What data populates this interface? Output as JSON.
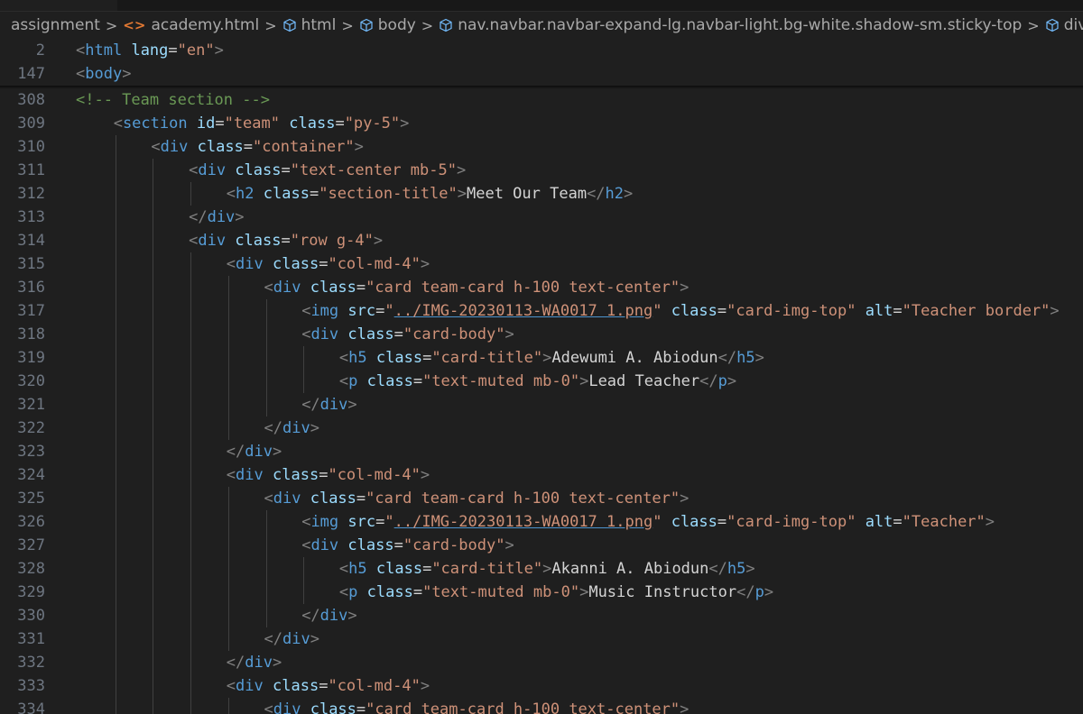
{
  "breadcrumb": {
    "folder": "assignment",
    "file": "academy.html",
    "nodes": [
      "html",
      "body",
      "nav.navbar.navbar-expand-lg.navbar-light.bg-white.shadow-sm.sticky-top",
      "div.container"
    ],
    "icons": {
      "file": "html-file-icon",
      "node": "symbol-element-icon"
    }
  },
  "sticky_lines": [
    {
      "number": "2",
      "tokens": [
        [
          "tg",
          "<"
        ],
        [
          "tn",
          "html"
        ],
        [
          "tx",
          " "
        ],
        [
          "at",
          "lang"
        ],
        [
          "tx",
          "="
        ],
        [
          "st",
          "\"en\""
        ],
        [
          "tg",
          ">"
        ]
      ]
    },
    {
      "number": "147",
      "tokens": [
        [
          "tg",
          "<"
        ],
        [
          "tn",
          "body"
        ],
        [
          "tg",
          ">"
        ]
      ]
    }
  ],
  "lines": [
    {
      "number": "308",
      "indent": 0,
      "tokens": [
        [
          "cm",
          "<!-- Team section -->"
        ]
      ]
    },
    {
      "number": "309",
      "indent": 1,
      "tokens": [
        [
          "tg",
          "<"
        ],
        [
          "tn",
          "section"
        ],
        [
          "tx",
          " "
        ],
        [
          "at",
          "id"
        ],
        [
          "tx",
          "="
        ],
        [
          "st",
          "\"team\""
        ],
        [
          "tx",
          " "
        ],
        [
          "at",
          "class"
        ],
        [
          "tx",
          "="
        ],
        [
          "st",
          "\"py-5\""
        ],
        [
          "tg",
          ">"
        ]
      ]
    },
    {
      "number": "310",
      "indent": 2,
      "tokens": [
        [
          "tg",
          "<"
        ],
        [
          "tn",
          "div"
        ],
        [
          "tx",
          " "
        ],
        [
          "at",
          "class"
        ],
        [
          "tx",
          "="
        ],
        [
          "st",
          "\"container\""
        ],
        [
          "tg",
          ">"
        ]
      ]
    },
    {
      "number": "311",
      "indent": 3,
      "tokens": [
        [
          "tg",
          "<"
        ],
        [
          "tn",
          "div"
        ],
        [
          "tx",
          " "
        ],
        [
          "at",
          "class"
        ],
        [
          "tx",
          "="
        ],
        [
          "st",
          "\"text-center mb-5\""
        ],
        [
          "tg",
          ">"
        ]
      ]
    },
    {
      "number": "312",
      "indent": 4,
      "tokens": [
        [
          "tg",
          "<"
        ],
        [
          "tn",
          "h2"
        ],
        [
          "tx",
          " "
        ],
        [
          "at",
          "class"
        ],
        [
          "tx",
          "="
        ],
        [
          "st",
          "\"section-title\""
        ],
        [
          "tg",
          ">"
        ],
        [
          "tx",
          "Meet Our Team"
        ],
        [
          "tg",
          "</"
        ],
        [
          "tn",
          "h2"
        ],
        [
          "tg",
          ">"
        ]
      ]
    },
    {
      "number": "313",
      "indent": 3,
      "tokens": [
        [
          "tg",
          "</"
        ],
        [
          "tn",
          "div"
        ],
        [
          "tg",
          ">"
        ]
      ]
    },
    {
      "number": "314",
      "indent": 3,
      "tokens": [
        [
          "tg",
          "<"
        ],
        [
          "tn",
          "div"
        ],
        [
          "tx",
          " "
        ],
        [
          "at",
          "class"
        ],
        [
          "tx",
          "="
        ],
        [
          "st",
          "\"row g-4\""
        ],
        [
          "tg",
          ">"
        ]
      ]
    },
    {
      "number": "315",
      "indent": 4,
      "tokens": [
        [
          "tg",
          "<"
        ],
        [
          "tn",
          "div"
        ],
        [
          "tx",
          " "
        ],
        [
          "at",
          "class"
        ],
        [
          "tx",
          "="
        ],
        [
          "st",
          "\"col-md-4\""
        ],
        [
          "tg",
          ">"
        ]
      ]
    },
    {
      "number": "316",
      "indent": 5,
      "tokens": [
        [
          "tg",
          "<"
        ],
        [
          "tn",
          "div"
        ],
        [
          "tx",
          " "
        ],
        [
          "at",
          "class"
        ],
        [
          "tx",
          "="
        ],
        [
          "st",
          "\"card team-card h-100 text-center\""
        ],
        [
          "tg",
          ">"
        ]
      ]
    },
    {
      "number": "317",
      "indent": 6,
      "tokens": [
        [
          "tg",
          "<"
        ],
        [
          "tn",
          "img"
        ],
        [
          "tx",
          " "
        ],
        [
          "at",
          "src"
        ],
        [
          "tx",
          "="
        ],
        [
          "st",
          "\""
        ],
        [
          "stu",
          "../IMG-20230113-WA0017 1.png"
        ],
        [
          "st",
          "\""
        ],
        [
          "tx",
          " "
        ],
        [
          "at",
          "class"
        ],
        [
          "tx",
          "="
        ],
        [
          "st",
          "\"card-img-top\""
        ],
        [
          "tx",
          " "
        ],
        [
          "at",
          "alt"
        ],
        [
          "tx",
          "="
        ],
        [
          "st",
          "\"Teacher border\""
        ],
        [
          "tg",
          ">"
        ]
      ]
    },
    {
      "number": "318",
      "indent": 6,
      "tokens": [
        [
          "tg",
          "<"
        ],
        [
          "tn",
          "div"
        ],
        [
          "tx",
          " "
        ],
        [
          "at",
          "class"
        ],
        [
          "tx",
          "="
        ],
        [
          "st",
          "\"card-body\""
        ],
        [
          "tg",
          ">"
        ]
      ]
    },
    {
      "number": "319",
      "indent": 7,
      "tokens": [
        [
          "tg",
          "<"
        ],
        [
          "tn",
          "h5"
        ],
        [
          "tx",
          " "
        ],
        [
          "at",
          "class"
        ],
        [
          "tx",
          "="
        ],
        [
          "st",
          "\"card-title\""
        ],
        [
          "tg",
          ">"
        ],
        [
          "tx",
          "Adewumi A. Abiodun"
        ],
        [
          "tg",
          "</"
        ],
        [
          "tn",
          "h5"
        ],
        [
          "tg",
          ">"
        ]
      ]
    },
    {
      "number": "320",
      "indent": 7,
      "tokens": [
        [
          "tg",
          "<"
        ],
        [
          "tn",
          "p"
        ],
        [
          "tx",
          " "
        ],
        [
          "at",
          "class"
        ],
        [
          "tx",
          "="
        ],
        [
          "st",
          "\"text-muted mb-0\""
        ],
        [
          "tg",
          ">"
        ],
        [
          "tx",
          "Lead Teacher"
        ],
        [
          "tg",
          "</"
        ],
        [
          "tn",
          "p"
        ],
        [
          "tg",
          ">"
        ]
      ]
    },
    {
      "number": "321",
      "indent": 6,
      "tokens": [
        [
          "tg",
          "</"
        ],
        [
          "tn",
          "div"
        ],
        [
          "tg",
          ">"
        ]
      ]
    },
    {
      "number": "322",
      "indent": 5,
      "tokens": [
        [
          "tg",
          "</"
        ],
        [
          "tn",
          "div"
        ],
        [
          "tg",
          ">"
        ]
      ]
    },
    {
      "number": "323",
      "indent": 4,
      "tokens": [
        [
          "tg",
          "</"
        ],
        [
          "tn",
          "div"
        ],
        [
          "tg",
          ">"
        ]
      ]
    },
    {
      "number": "324",
      "indent": 4,
      "tokens": [
        [
          "tg",
          "<"
        ],
        [
          "tn",
          "div"
        ],
        [
          "tx",
          " "
        ],
        [
          "at",
          "class"
        ],
        [
          "tx",
          "="
        ],
        [
          "st",
          "\"col-md-4\""
        ],
        [
          "tg",
          ">"
        ]
      ]
    },
    {
      "number": "325",
      "indent": 5,
      "tokens": [
        [
          "tg",
          "<"
        ],
        [
          "tn",
          "div"
        ],
        [
          "tx",
          " "
        ],
        [
          "at",
          "class"
        ],
        [
          "tx",
          "="
        ],
        [
          "st",
          "\"card team-card h-100 text-center\""
        ],
        [
          "tg",
          ">"
        ]
      ]
    },
    {
      "number": "326",
      "indent": 6,
      "tokens": [
        [
          "tg",
          "<"
        ],
        [
          "tn",
          "img"
        ],
        [
          "tx",
          " "
        ],
        [
          "at",
          "src"
        ],
        [
          "tx",
          "="
        ],
        [
          "st",
          "\""
        ],
        [
          "stu",
          "../IMG-20230113-WA0017 1.png"
        ],
        [
          "st",
          "\""
        ],
        [
          "tx",
          " "
        ],
        [
          "at",
          "class"
        ],
        [
          "tx",
          "="
        ],
        [
          "st",
          "\"card-img-top\""
        ],
        [
          "tx",
          " "
        ],
        [
          "at",
          "alt"
        ],
        [
          "tx",
          "="
        ],
        [
          "st",
          "\"Teacher\""
        ],
        [
          "tg",
          ">"
        ]
      ]
    },
    {
      "number": "327",
      "indent": 6,
      "tokens": [
        [
          "tg",
          "<"
        ],
        [
          "tn",
          "div"
        ],
        [
          "tx",
          " "
        ],
        [
          "at",
          "class"
        ],
        [
          "tx",
          "="
        ],
        [
          "st",
          "\"card-body\""
        ],
        [
          "tg",
          ">"
        ]
      ]
    },
    {
      "number": "328",
      "indent": 7,
      "tokens": [
        [
          "tg",
          "<"
        ],
        [
          "tn",
          "h5"
        ],
        [
          "tx",
          " "
        ],
        [
          "at",
          "class"
        ],
        [
          "tx",
          "="
        ],
        [
          "st",
          "\"card-title\""
        ],
        [
          "tg",
          ">"
        ],
        [
          "tx",
          "Akanni A. Abiodun"
        ],
        [
          "tg",
          "</"
        ],
        [
          "tn",
          "h5"
        ],
        [
          "tg",
          ">"
        ]
      ]
    },
    {
      "number": "329",
      "indent": 7,
      "tokens": [
        [
          "tg",
          "<"
        ],
        [
          "tn",
          "p"
        ],
        [
          "tx",
          " "
        ],
        [
          "at",
          "class"
        ],
        [
          "tx",
          "="
        ],
        [
          "st",
          "\"text-muted mb-0\""
        ],
        [
          "tg",
          ">"
        ],
        [
          "tx",
          "Music Instructor"
        ],
        [
          "tg",
          "</"
        ],
        [
          "tn",
          "p"
        ],
        [
          "tg",
          ">"
        ]
      ]
    },
    {
      "number": "330",
      "indent": 6,
      "tokens": [
        [
          "tg",
          "</"
        ],
        [
          "tn",
          "div"
        ],
        [
          "tg",
          ">"
        ]
      ]
    },
    {
      "number": "331",
      "indent": 5,
      "tokens": [
        [
          "tg",
          "</"
        ],
        [
          "tn",
          "div"
        ],
        [
          "tg",
          ">"
        ]
      ]
    },
    {
      "number": "332",
      "indent": 4,
      "tokens": [
        [
          "tg",
          "</"
        ],
        [
          "tn",
          "div"
        ],
        [
          "tg",
          ">"
        ]
      ]
    },
    {
      "number": "333",
      "indent": 4,
      "tokens": [
        [
          "tg",
          "<"
        ],
        [
          "tn",
          "div"
        ],
        [
          "tx",
          " "
        ],
        [
          "at",
          "class"
        ],
        [
          "tx",
          "="
        ],
        [
          "st",
          "\"col-md-4\""
        ],
        [
          "tg",
          ">"
        ]
      ]
    },
    {
      "number": "334",
      "indent": 5,
      "tokens": [
        [
          "tg",
          "<"
        ],
        [
          "tn",
          "div"
        ],
        [
          "tx",
          " "
        ],
        [
          "at",
          "class"
        ],
        [
          "tx",
          "="
        ],
        [
          "st",
          "\"card team-card h-100 text-center\""
        ],
        [
          "tg",
          ">"
        ]
      ]
    }
  ],
  "colors": {
    "background": "#1f1f1f",
    "line_number": "#6e7681",
    "tag_bracket": "#808080",
    "tag_name": "#569cd6",
    "attribute": "#9cdcfe",
    "string": "#ce9178",
    "text": "#d4d4d4",
    "comment": "#6a9955",
    "indent_guide": "#404040"
  }
}
